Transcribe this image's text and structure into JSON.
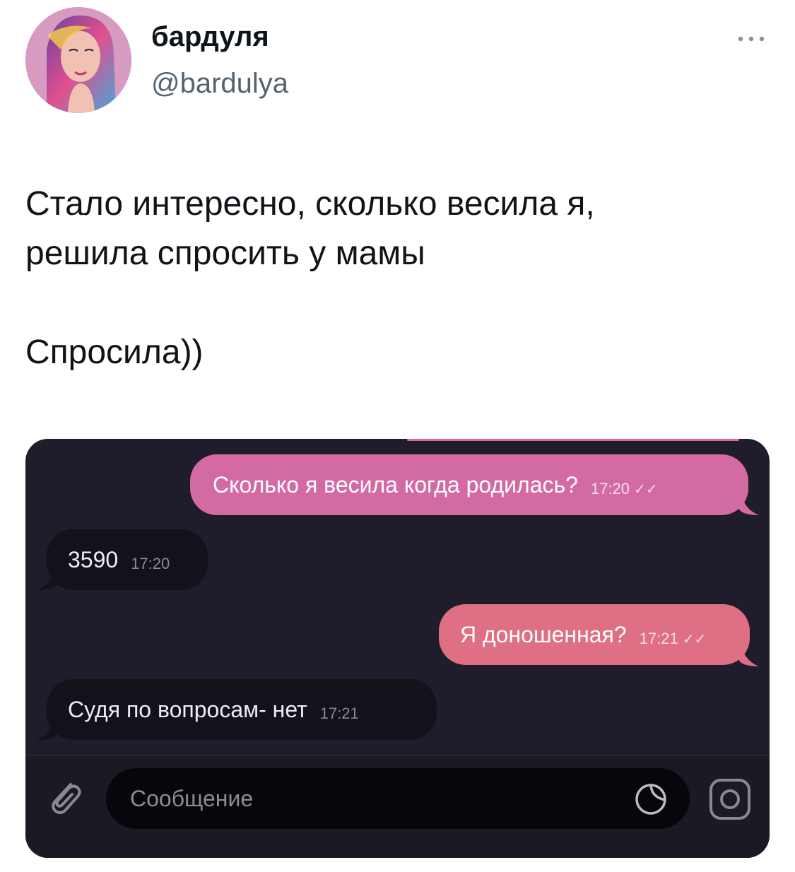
{
  "author": {
    "display_name": "бардуля",
    "handle": "@bardulya"
  },
  "tweet": {
    "line1": "Стало интересно, сколько весила я,",
    "line2": "решила спросить у мамы",
    "line3": "Спросила))"
  },
  "chat": {
    "messages": [
      {
        "direction": "outgoing",
        "text": "Сколько я весила когда родилась?",
        "time": "17:20",
        "read_mark": "✓✓"
      },
      {
        "direction": "incoming",
        "text": "3590",
        "time": "17:20"
      },
      {
        "direction": "outgoing",
        "text": "Я доношенная?",
        "time": "17:21",
        "read_mark": "✓✓"
      },
      {
        "direction": "incoming",
        "text": "Судя по вопросам- нет",
        "time": "17:21"
      }
    ],
    "composer": {
      "placeholder": "Сообщение"
    }
  },
  "colors": {
    "outgoing_bubble_1": "#d46aa4",
    "outgoing_bubble_2": "#de6f84",
    "incoming_bubble": "#131119",
    "chat_background": "#1f1c2b"
  },
  "icons": [
    "more-icon",
    "attach-icon",
    "sticker-icon",
    "camera-icon"
  ]
}
